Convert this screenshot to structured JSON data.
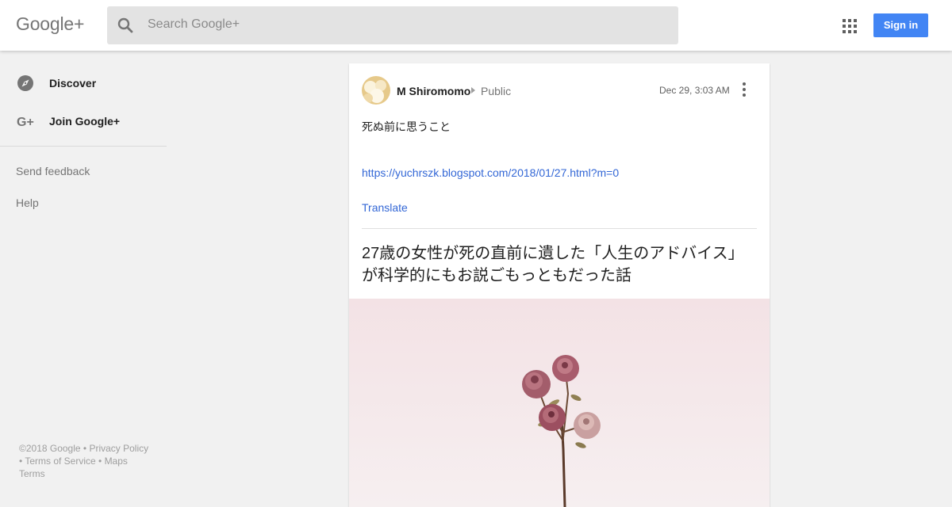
{
  "header": {
    "logo": "Google+",
    "search_placeholder": "Search Google+",
    "apps_icon": "apps-grid-icon",
    "signin_label": "Sign in",
    "accent": "#4285f4"
  },
  "sidebar": {
    "items": [
      {
        "label": "Discover",
        "icon": "compass-icon"
      },
      {
        "label": "Join Google+",
        "icon": "google-plus-icon"
      }
    ],
    "links": [
      "Send feedback",
      "Help"
    ],
    "footer": {
      "copyright": "©2018 Google",
      "privacy": "Privacy Policy",
      "terms_of_service": "Terms of Service",
      "maps": "Maps",
      "terms": "Terms"
    }
  },
  "post": {
    "author": "M Shiromomo",
    "visibility": "Public",
    "timestamp": "Dec 29, 3:03 AM",
    "text": "死ぬ前に思うこと",
    "link_url": "https://yuchrszk.blogspot.com/2018/01/27.html?m=0",
    "translate_label": "Translate",
    "link_title": "27歳の女性が死の直前に遺した「人生のアドバイス」が科学的にもお説ごもっともだった話",
    "link_color": "#3367d6"
  }
}
